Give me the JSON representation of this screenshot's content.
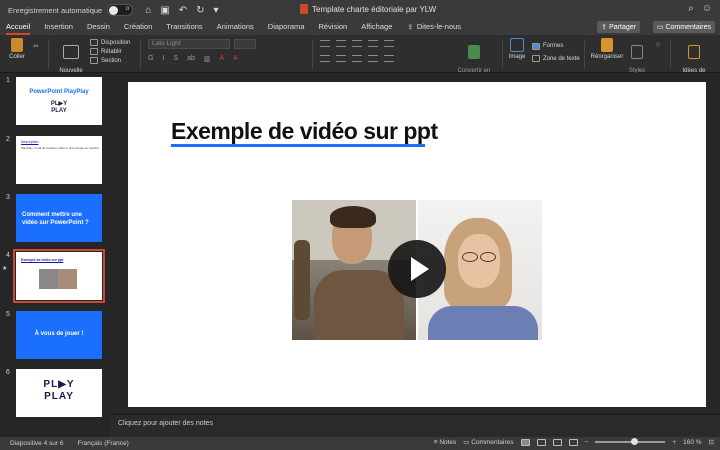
{
  "titlebar": {
    "autosave_label": "Enregistrement automatique",
    "autosave_state": "o",
    "document_title": "Template charte éditoriale par YLW"
  },
  "tabs": [
    "Accueil",
    "Insertion",
    "Dessin",
    "Création",
    "Transitions",
    "Animations",
    "Diaporama",
    "Révision",
    "Affichage",
    "Dites-le-nous"
  ],
  "header_buttons": {
    "share": "Partager",
    "comments": "Commentaires"
  },
  "ribbon": {
    "paste": "Coller",
    "new_slide": "Nouvelle\ndiapositive",
    "layout": "Disposition",
    "reset": "Rétablir",
    "section": "Section",
    "font_name": "Lato Light",
    "convert_smartart": "Convertir en\ngraphique SmartArt",
    "image": "Image",
    "shapes": "Formes",
    "text_box": "Zone de texte",
    "arrange": "Réorganiser",
    "quick_styles": "Styles\nrapides",
    "design_ideas": "Idées de\nconception"
  },
  "thumbnails": [
    {
      "num": "1",
      "title": "PowerPoint PlayPlay",
      "logo": "PL▶Y\nPLAY"
    },
    {
      "num": "2",
      "heading": "Description",
      "text": "PlayPlay: l'outil de création vidéo le plus simple du marché"
    },
    {
      "num": "3",
      "text": "Comment mettre une vidéo sur PowerPoint ?"
    },
    {
      "num": "4",
      "heading": "Exemple de vidéo sur ppt"
    },
    {
      "num": "5",
      "text": "À vous de jouer !"
    },
    {
      "num": "6",
      "logo": "PL▶Y\nPLAY"
    }
  ],
  "slide": {
    "title": "Exemple de vidéo sur ppt"
  },
  "notes_placeholder": "Cliquez pour ajouter des notes",
  "status": {
    "slide_position": "Diapositive 4 sur 6",
    "language": "Français (France)",
    "notes": "Notes",
    "comments": "Commentaires",
    "zoom": "160 %"
  },
  "colors": {
    "accent": "#d24726",
    "brand_blue": "#1a6fff"
  }
}
